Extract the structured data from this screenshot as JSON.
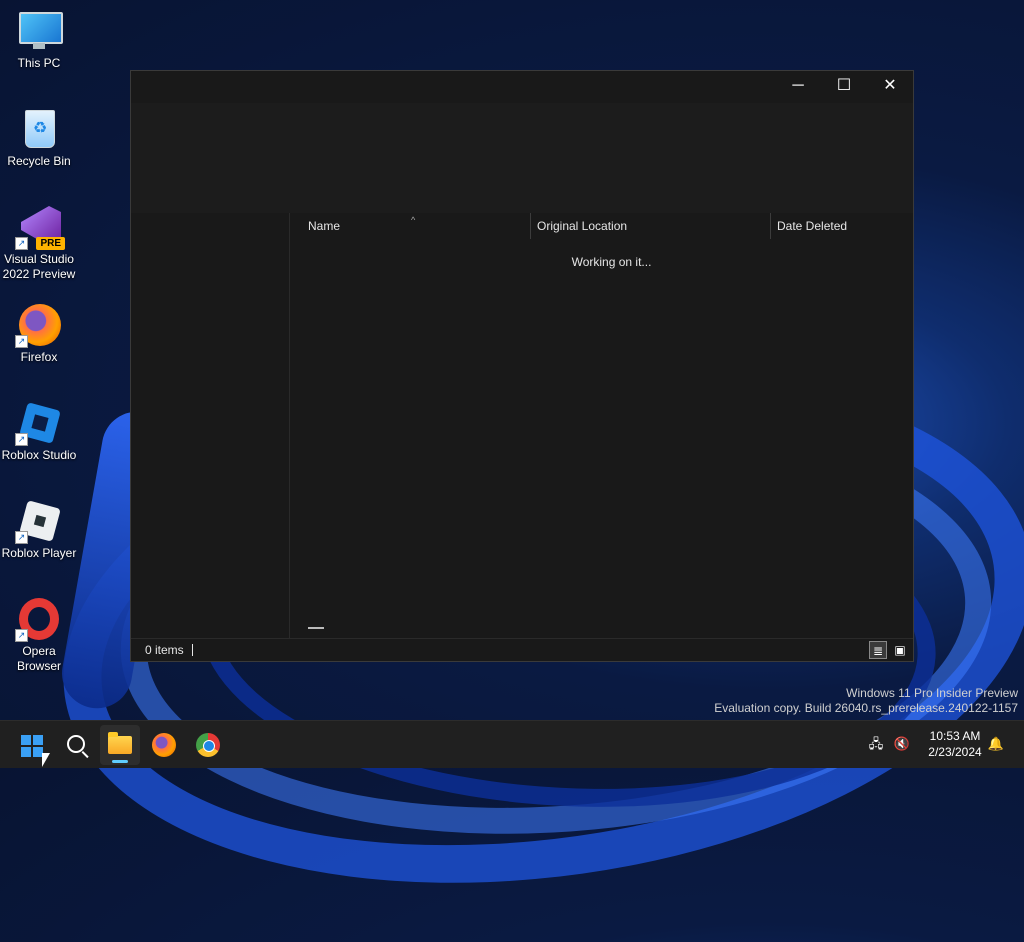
{
  "desktop": {
    "icons": [
      {
        "label": "This PC",
        "icon": "monitor-icon"
      },
      {
        "label": "Recycle Bin",
        "icon": "recycle-bin-icon"
      },
      {
        "label": "Visual Studio 2022 Preview",
        "icon": "visual-studio-icon",
        "badge": "PRE"
      },
      {
        "label": "Firefox",
        "icon": "firefox-icon"
      },
      {
        "label": "Roblox Studio",
        "icon": "roblox-studio-icon"
      },
      {
        "label": "Roblox Player",
        "icon": "roblox-player-icon"
      },
      {
        "label": "Opera Browser",
        "icon": "opera-icon"
      }
    ],
    "shortcut_glyph": "↗"
  },
  "window": {
    "controls": {
      "minimize": "─",
      "maximize": "☐",
      "close": "✕"
    },
    "columns": [
      "Name",
      "Original Location",
      "Date Deleted"
    ],
    "sort_indicator": "^",
    "loading_text": "Working on it...",
    "status": {
      "item_count": "0 items"
    },
    "view_buttons": {
      "details": "≣",
      "tiles": "▣"
    }
  },
  "watermark": {
    "line1": "Windows 11 Pro Insider Preview",
    "line2": "Evaluation copy. Build 26040.rs_prerelease.240122-1157"
  },
  "taskbar": {
    "pinned": [
      "windows-start-icon",
      "search-icon",
      "file-explorer-icon",
      "firefox-icon",
      "chrome-icon"
    ],
    "tray": {
      "network_glyph": "🖧",
      "volume_glyph": "🔇",
      "time": "10:53 AM",
      "date": "2/23/2024",
      "notification_glyph": "🔔"
    }
  },
  "colors": {
    "window_bg": "#191919",
    "taskbar_bg": "#202020",
    "accent": "#60cdff",
    "wallpaper_blue": "#1f55e0"
  }
}
